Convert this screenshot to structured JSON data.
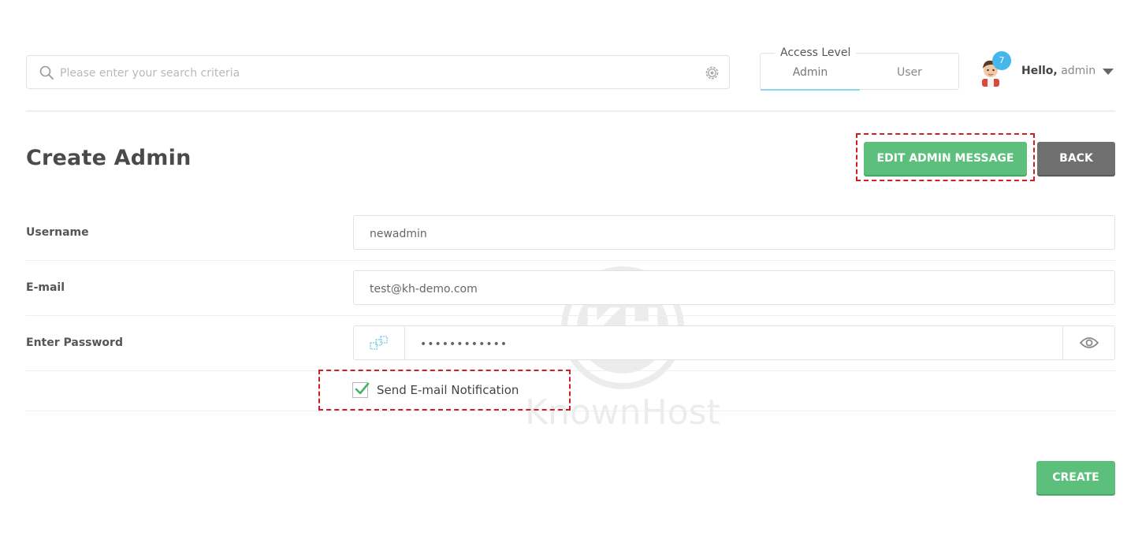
{
  "search": {
    "placeholder": "Please enter your search criteria"
  },
  "access_level": {
    "title": "Access Level",
    "tabs": [
      {
        "label": "Admin",
        "active": true
      },
      {
        "label": "User",
        "active": false
      }
    ]
  },
  "user": {
    "greeting": "Hello,",
    "name": "admin",
    "notification_count": "7"
  },
  "page": {
    "title": "Create Admin"
  },
  "actions": {
    "edit_admin_message": "EDIT ADMIN MESSAGE",
    "back": "BACK",
    "create": "CREATE"
  },
  "form": {
    "username": {
      "label": "Username",
      "value": "newadmin"
    },
    "email": {
      "label": "E-mail",
      "value": "test@kh-demo.com"
    },
    "password": {
      "label": "Enter Password",
      "value": "••••••••••••"
    },
    "notification": {
      "label": "Send E-mail Notification",
      "checked": true
    }
  },
  "watermark": {
    "text": "KnownHost"
  },
  "colors": {
    "primary_green": "#5cc07c",
    "back_gray": "#6f6f6f",
    "badge_blue": "#45b7ea",
    "highlight_red": "#d01e26"
  }
}
